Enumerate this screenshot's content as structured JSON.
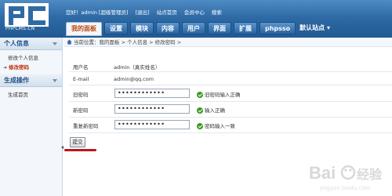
{
  "logo": {
    "text": "PC",
    "sub": "PHPCMS.CN"
  },
  "topbar": {
    "greeting": "您好！admin [超级管理员]",
    "logout": "[退出]",
    "site_home": "站点首页",
    "member_center": "会员中心",
    "search": "搜索"
  },
  "nav": {
    "tabs": [
      {
        "label": "我的面板"
      },
      {
        "label": "设置"
      },
      {
        "label": "模块"
      },
      {
        "label": "内容"
      },
      {
        "label": "用户"
      },
      {
        "label": "界面"
      },
      {
        "label": "扩展"
      },
      {
        "label": "phpsso"
      }
    ],
    "site_select": "默认站点"
  },
  "sidebar": {
    "sections": [
      {
        "title": "个人信息",
        "items": [
          "修改个人信息",
          "修改密码"
        ]
      },
      {
        "title": "生成操作",
        "items": [
          "生成首页"
        ]
      }
    ]
  },
  "breadcrumb": "当前位置：我的面板 > 个人信息 > 修改密码 >",
  "form": {
    "username_label": "用户名",
    "username_value": "admin（真实姓名）",
    "email_label": "E-mail",
    "email_value": "admin@qq.com",
    "old_label": "旧密码",
    "old_value": "••••••••••••",
    "old_tip": "旧密码输入正确",
    "new_label": "新密码",
    "new_value": "••••••••••••",
    "new_tip": "输入正确",
    "repeat_label": "重复新密码",
    "repeat_value": "••••••••••••",
    "repeat_tip": "密码输入一致",
    "submit": "提交"
  },
  "watermark": {
    "text": "Bai",
    "sub": "jingyan.baidu.com"
  },
  "colors": {
    "header": "#2f6aa6",
    "active_tab_text": "#c04a12",
    "ok_green": "#3a9a1d",
    "underline_red": "#c0141c"
  }
}
